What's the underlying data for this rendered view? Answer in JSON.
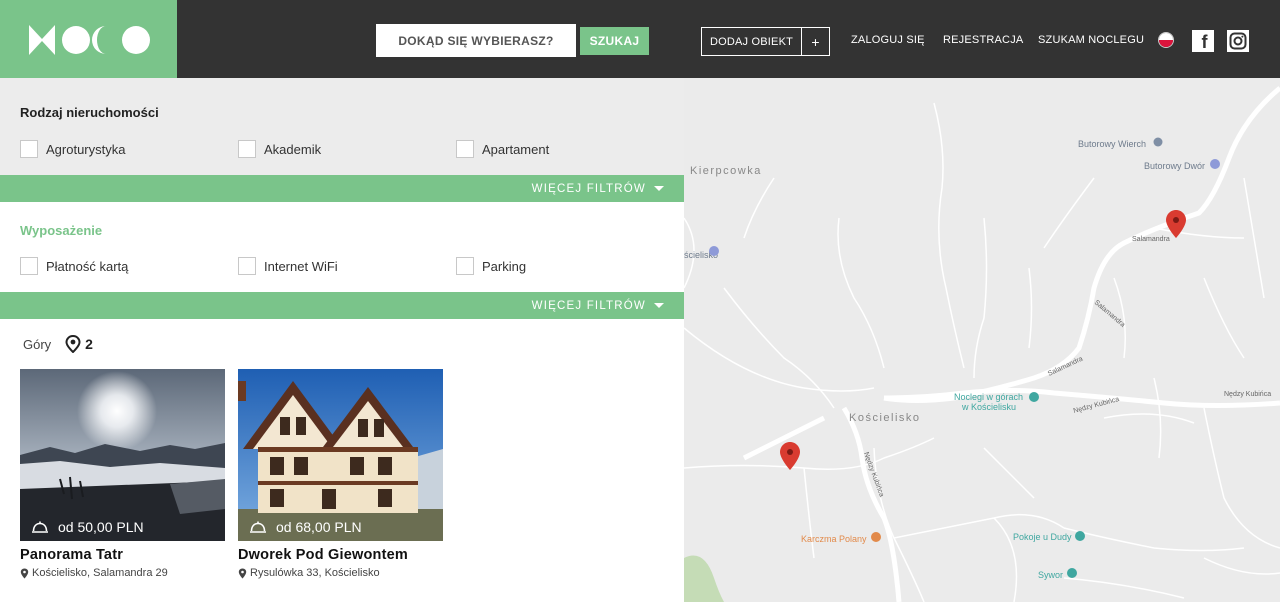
{
  "header": {
    "search_placeholder": "DOKĄD SIĘ WYBIERASZ?",
    "search_button": "SZUKAJ",
    "add_listing": "DODAJ OBIEKT",
    "add_plus": "+",
    "nav": [
      "ZALOGUJ SIĘ",
      "REJESTRACJA",
      "SZUKAM NOCLEGU"
    ],
    "facebook_letter": "f"
  },
  "filters": {
    "property_type": {
      "title": "Rodzaj nieruchomości",
      "options": [
        "Agroturystyka",
        "Akademik",
        "Apartament"
      ],
      "more": "WIĘCEJ FILTRÓW"
    },
    "amenities": {
      "title": "Wyposażenie",
      "options": [
        "Płatność kartą",
        "Internet WiFi",
        "Parking"
      ],
      "more": "WIĘCEJ FILTRÓW"
    }
  },
  "results": {
    "location": "Góry",
    "count": "2",
    "cards": [
      {
        "price": "od 50,00 PLN",
        "name": "Panorama Tatr",
        "address": "Kościelisko, Salamandra 29"
      },
      {
        "price": "od 68,00 PLN",
        "name": "Dworek Pod Giewontem",
        "address": "Rysulówka 33, Kościelisko"
      }
    ]
  },
  "map": {
    "places": [
      "Kierpcowka",
      "Butorowy Wierch",
      "Butorowy Dwór",
      "Kościelisko",
      "Noclegi w górach",
      "w Kościelisku",
      "Karczma Polany",
      "Pokoje u Dudy",
      "Sywor",
      "ścielisko"
    ],
    "streets": [
      "Salamandra",
      "Salamandra",
      "Salamandra",
      "Nędzy Kubińca",
      "Nędzy Kubińca",
      "Nędzy Kubińca"
    ]
  },
  "colors": {
    "accent": "#7ac48a",
    "header": "#333333",
    "pin": "#d93b30"
  }
}
